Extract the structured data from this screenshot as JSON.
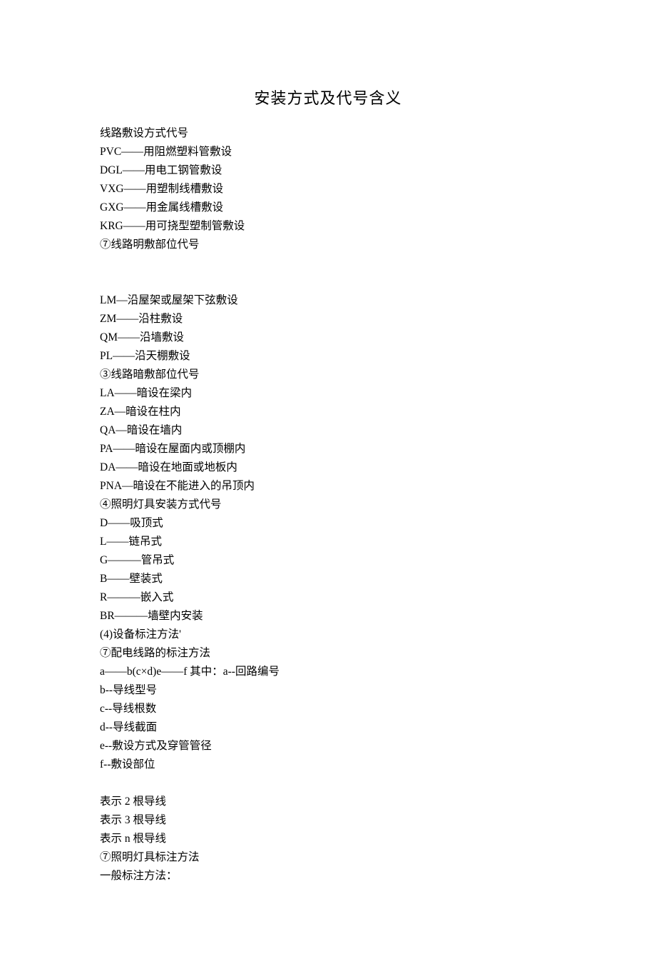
{
  "title": "安装方式及代号含义",
  "sections": [
    {
      "lines": [
        "线路敷设方式代号",
        "PVC——用阻燃塑料管敷设",
        "DGL——用电工钢管敷设",
        "VXG——用塑制线槽敷设",
        "GXG——用金属线槽敷设",
        "KRG——用可挠型塑制管敷设",
        "⑦线路明敷部位代号"
      ]
    },
    {
      "lines": [
        "LM—沿屋架或屋架下弦敷设",
        "ZM——沿柱敷设",
        "QM——沿墙敷设",
        "PL——沿天棚敷设",
        "③线路暗敷部位代号",
        "LA——暗设在梁内",
        "ZA—暗设在柱内",
        "QA—暗设在墙内",
        "PA——暗设在屋面内或顶棚内",
        "DA——暗设在地面或地板内",
        "PNA—暗设在不能进入的吊顶内",
        "④照明灯具安装方式代号",
        "D——吸顶式",
        "L——链吊式",
        "G———管吊式",
        "B——壁装式",
        "R———嵌入式",
        "BR———墙壁内安装",
        "(4)设备标注方法'",
        "⑦配电线路的标注方法",
        "a——b(c×d)e——f 其中：a--回路编号",
        "b--导线型号",
        "c--导线根数",
        "d--导线截面",
        "e--敷设方式及穿管管径",
        "f--敷设部位"
      ]
    },
    {
      "lines": [
        "表示 2 根导线",
        "表示 3 根导线",
        "表示 n 根导线",
        "⑦照明灯具标注方法",
        "一般标注方法："
      ]
    }
  ]
}
